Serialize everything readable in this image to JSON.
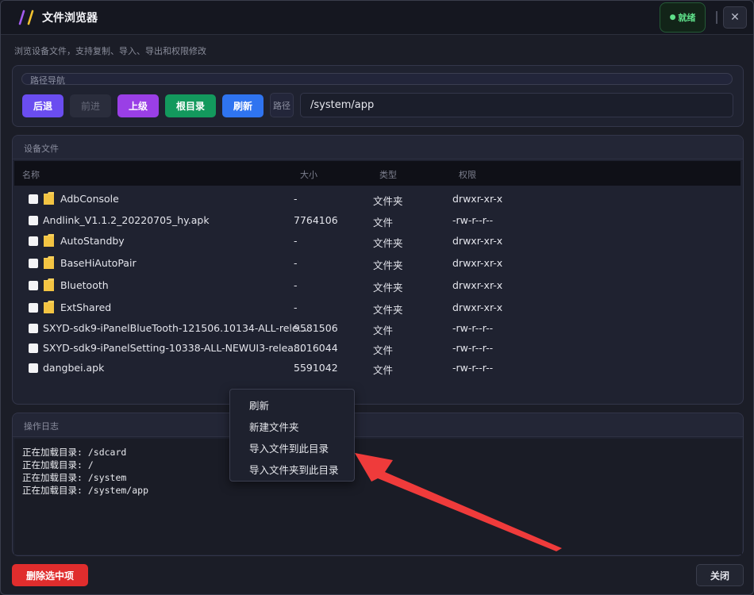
{
  "window": {
    "title": "文件浏览器",
    "logo_icon": "double-slash-logo",
    "status": "就绪",
    "status_color": "#5fe08a",
    "close_glyph": "✕",
    "subtitle": "浏览设备文件，支持复制、导入、导出和权限修改"
  },
  "path_nav": {
    "title": "路径导航",
    "buttons": {
      "back": "后退",
      "forward": "前进",
      "up": "上级",
      "root": "根目录",
      "refresh": "刷新"
    },
    "path_label": "路径",
    "path_value": "/system/app"
  },
  "files": {
    "title": "设备文件",
    "columns": {
      "name": "名称",
      "size": "大小",
      "type": "类型",
      "perm": "权限"
    },
    "rows": [
      {
        "name": "AdbConsole",
        "size": "-",
        "type": "文件夹",
        "perm": "drwxr-xr-x",
        "folder": true
      },
      {
        "name": "Andlink_V1.1.2_20220705_hy.apk",
        "size": "7764106",
        "type": "文件",
        "perm": "-rw-r--r--",
        "folder": false
      },
      {
        "name": "AutoStandby",
        "size": "-",
        "type": "文件夹",
        "perm": "drwxr-xr-x",
        "folder": true
      },
      {
        "name": "BaseHiAutoPair",
        "size": "-",
        "type": "文件夹",
        "perm": "drwxr-xr-x",
        "folder": true
      },
      {
        "name": "Bluetooth",
        "size": "-",
        "type": "文件夹",
        "perm": "drwxr-xr-x",
        "folder": true
      },
      {
        "name": "ExtShared",
        "size": "-",
        "type": "文件夹",
        "perm": "drwxr-xr-x",
        "folder": true
      },
      {
        "name": "SXYD-sdk9-iPanelBlueTooth-121506.10134-ALL-rele...",
        "size": "9581506",
        "type": "文件",
        "perm": "-rw-r--r--",
        "folder": false
      },
      {
        "name": "SXYD-sdk9-iPanelSetting-10338-ALL-NEWUI3-relea...",
        "size": "8016044",
        "type": "文件",
        "perm": "-rw-r--r--",
        "folder": false
      },
      {
        "name": "dangbei.apk",
        "size": "5591042",
        "type": "文件",
        "perm": "-rw-r--r--",
        "folder": false
      }
    ]
  },
  "log": {
    "title": "操作日志",
    "lines": [
      "正在加载目录: /sdcard",
      "正在加载目录: /",
      "正在加载目录: /system",
      "正在加载目录: /system/app"
    ]
  },
  "context_menu": {
    "items": [
      "刷新",
      "新建文件夹",
      "导入文件到此目录",
      "导入文件夹到此目录"
    ]
  },
  "annotation": {
    "arrow_color": "#ef3b3b"
  },
  "footer": {
    "delete_label": "删除选中项",
    "close_label": "关闭"
  }
}
